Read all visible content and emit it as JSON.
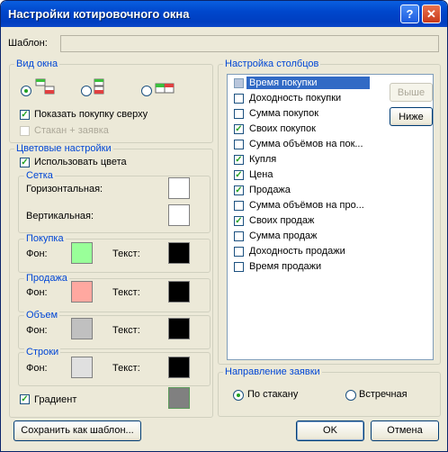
{
  "window": {
    "title": "Настройки котировочного окна",
    "help": "?",
    "close": "✕"
  },
  "template": {
    "label": "Шаблон:",
    "value": ""
  },
  "view": {
    "title": "Вид окна",
    "layouts": [
      {
        "name": "layout-vertical-buy-top",
        "selected": true
      },
      {
        "name": "layout-vertical-sell-top",
        "selected": false
      },
      {
        "name": "layout-horizontal",
        "selected": false
      }
    ],
    "show_buy_top": "Показать покупку сверху",
    "stack_plus_order": "Стакан + заявка"
  },
  "colors": {
    "title": "Цветовые настройки",
    "use_colors": "Использовать цвета",
    "grid": {
      "title": "Сетка",
      "horizontal": "Горизонтальная:",
      "vertical": "Вертикальная:",
      "h_color": "#ffffff",
      "v_color": "#ffffff"
    },
    "buy": {
      "title": "Покупка",
      "bg_label": "Фон:",
      "text_label": "Текст:",
      "bg": "#99ff99",
      "text": "#000000"
    },
    "sell": {
      "title": "Продажа",
      "bg_label": "Фон:",
      "text_label": "Текст:",
      "bg": "#ffa8a0",
      "text": "#000000"
    },
    "volume": {
      "title": "Объем",
      "bg_label": "Фон:",
      "text_label": "Текст:",
      "bg": "#c0c0c0",
      "text": "#000000"
    },
    "rows": {
      "title": "Строки",
      "bg_label": "Фон:",
      "text_label": "Текст:",
      "bg": "#e0e0e0",
      "text": "#000000"
    },
    "gradient": "Градиент",
    "gradient_color": "#808080"
  },
  "columns": {
    "title": "Настройка столбцов",
    "items": [
      {
        "label": "Время покупки",
        "checked": false,
        "selected": true
      },
      {
        "label": "Доходность покупки",
        "checked": false
      },
      {
        "label": "Сумма покупок",
        "checked": false
      },
      {
        "label": "Своих покупок",
        "checked": true
      },
      {
        "label": "Сумма объёмов на пок...",
        "checked": false
      },
      {
        "label": "Купля",
        "checked": true
      },
      {
        "label": "Цена",
        "checked": true
      },
      {
        "label": "Продажа",
        "checked": true
      },
      {
        "label": "Сумма объёмов на про...",
        "checked": false
      },
      {
        "label": "Своих продаж",
        "checked": true
      },
      {
        "label": "Сумма продаж",
        "checked": false
      },
      {
        "label": "Доходность продажи",
        "checked": false
      },
      {
        "label": "Время продажи",
        "checked": false
      }
    ],
    "up": "Выше",
    "down": "Ниже"
  },
  "direction": {
    "title": "Направление заявки",
    "by_stack": "По стакану",
    "counter": "Встречная"
  },
  "buttons": {
    "save_template": "Сохранить как шаблон...",
    "ok": "OK",
    "cancel": "Отмена"
  }
}
